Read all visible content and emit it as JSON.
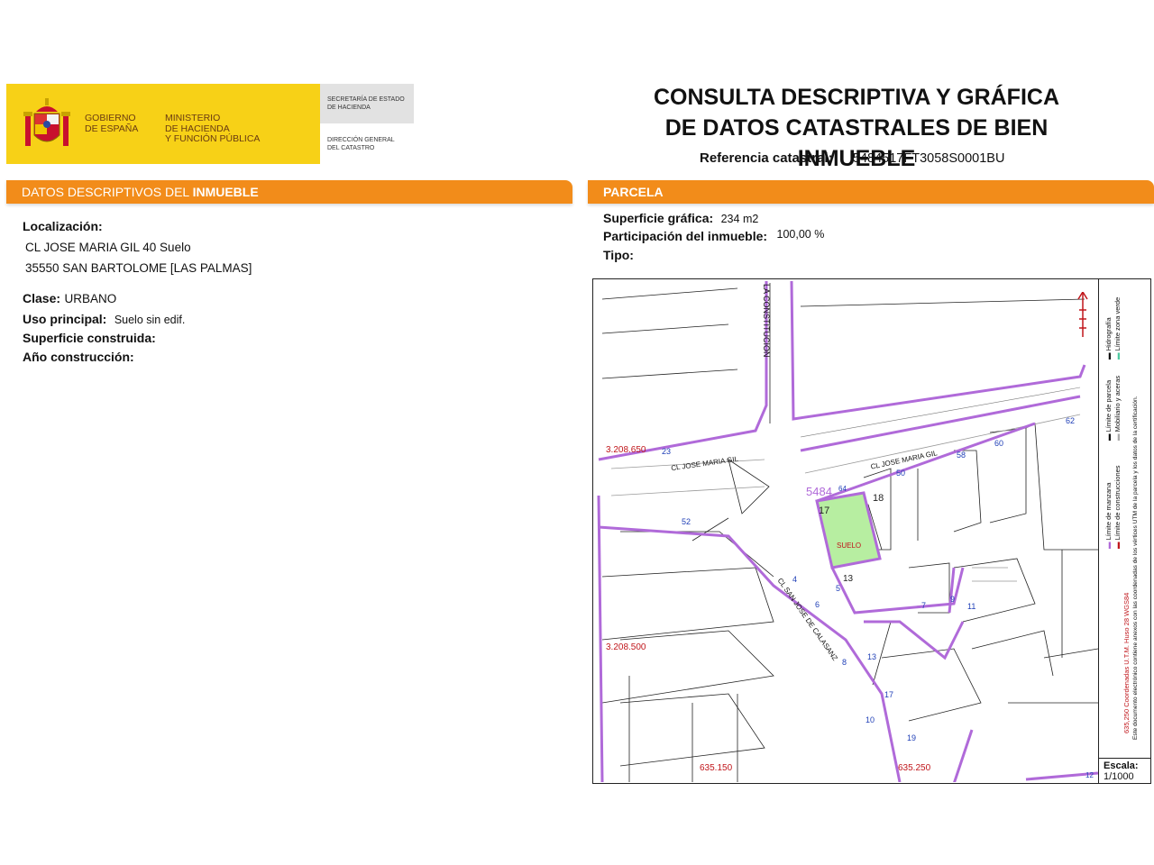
{
  "header": {
    "gov_lines": [
      "GOBIERNO",
      "DE ESPAÑA"
    ],
    "ministry_lines": [
      "MINISTERIO",
      "DE HACIENDA",
      "Y FUNCIÓN PÚBLICA"
    ],
    "secretaria_lines": [
      "SECRETARÍA DE ESTADO",
      "DE HACIENDA"
    ],
    "direccion_lines": [
      "DIRECCIÓN GENERAL",
      "DEL CATASTRO"
    ],
    "title_line1": "CONSULTA DESCRIPTIVA Y GRÁFICA",
    "title_line2": "DE DATOS CATASTRALES DE BIEN INMUEBLE",
    "ref_label": "Referencia catastral:",
    "ref_value": "5484517FT3058S0001BU"
  },
  "left_section": {
    "bar_label_a": "DATOS DESCRIPTIVOS DEL ",
    "bar_label_b": "INMUEBLE",
    "localizacion_label": "Localización:",
    "address_line1": "CL JOSE MARIA GIL 40 Suelo",
    "address_line2": "35550 SAN BARTOLOME [LAS PALMAS]",
    "clase_label": "Clase:",
    "clase_value": "URBANO",
    "uso_label": "Uso principal:",
    "uso_value": "Suelo sin edif.",
    "superficie_construida_label": "Superficie construida:",
    "anio_label": "Año construcción:"
  },
  "right_section": {
    "bar_label": "PARCELA",
    "superficie_label": "Superficie gráfica:",
    "superficie_value": "234 m2",
    "participacion_label": "Participación del inmueble:",
    "participacion_value": "100,00 %",
    "tipo_label": "Tipo:"
  },
  "map": {
    "street_constitucion": "LA CONSTITUCION",
    "street_jmg_left": "CL JOSE MARIA GIL",
    "street_jmg_right": "CL JOSE MARIA GIL",
    "street_san_jose": "CL SAN JOSE DE CALASANZ",
    "coord_y1": "3.208.650",
    "coord_y2": "3.208.500",
    "coord_x1": "635.150",
    "coord_x2": "635.250",
    "parcel_ref": "5484",
    "parcel_label": "SUELO",
    "numbers": {
      "n23": "23",
      "n52": "52",
      "n50": "50",
      "n58": "58",
      "n60": "60",
      "n62": "62",
      "n64": "64",
      "n18": "18",
      "n17": "17",
      "n13": "13",
      "n4": "4",
      "n6": "6",
      "n5": "5",
      "n8": "8",
      "n10": "10",
      "n13b": "13",
      "n17b": "17",
      "n19": "19",
      "n7": "7",
      "n9": "9",
      "n11": "11",
      "n12": "12"
    },
    "scale_label": "Escala:",
    "scale_value": "1/1000",
    "legend": {
      "manzana": "Límite de manzana",
      "parcela": "Límite de parcela",
      "hidrografia": "Hidrografía",
      "construcciones": "Límite de construcciones",
      "mobiliario": "Mobiliario y aceras",
      "zona_verde": "Límite zona verde",
      "coords": "635,250 Coordenadas U.T.M. Huso 28 WGS84",
      "note": "Este documento electrónico contiene anexos con las coordenadas de los vértices UTM de la parcela y los datos de la certificación."
    },
    "colors": {
      "boundary": "#b06ad9",
      "parcel_fill": "#b7eea1",
      "coord_red": "#c0161b",
      "number_blue": "#1f3fb7"
    }
  }
}
